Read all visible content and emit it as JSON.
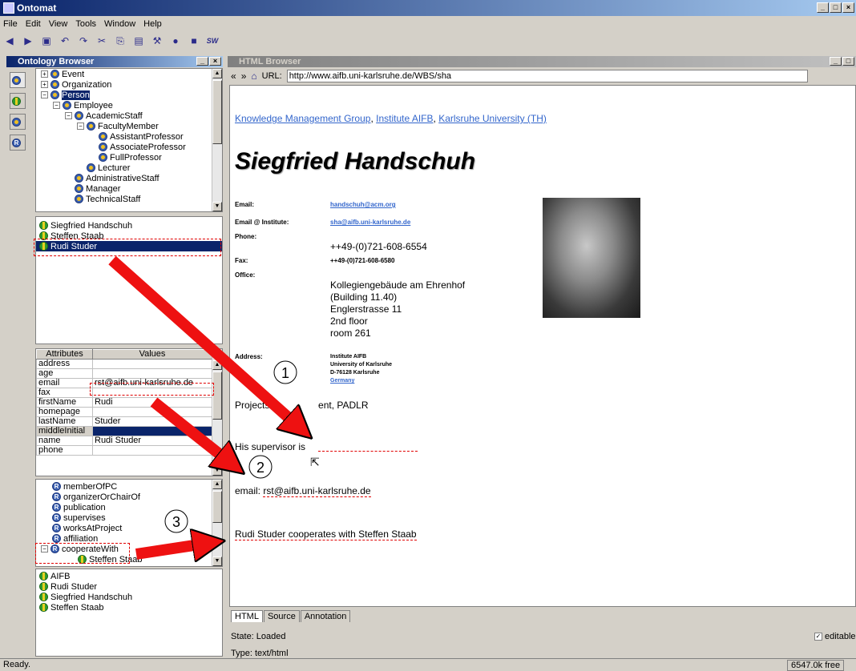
{
  "app": {
    "title": "Ontomat",
    "status": "Ready.",
    "memory": "6547.0k free"
  },
  "menu": [
    "File",
    "Edit",
    "View",
    "Tools",
    "Window",
    "Help"
  ],
  "toolbar": [
    {
      "icon": "back-icon",
      "glyph": "◀"
    },
    {
      "icon": "forward-icon",
      "glyph": "▶"
    },
    {
      "icon": "save-icon",
      "glyph": "▣"
    },
    {
      "icon": "undo-icon",
      "glyph": "↶"
    },
    {
      "icon": "redo-icon",
      "glyph": "↷"
    },
    {
      "icon": "cut-icon",
      "glyph": "✂"
    },
    {
      "icon": "copy-icon",
      "glyph": "⎘"
    },
    {
      "icon": "paste-icon",
      "glyph": "▤"
    },
    {
      "icon": "tools-icon",
      "glyph": "⚒"
    },
    {
      "icon": "ontology-icon",
      "glyph": "●"
    },
    {
      "icon": "database-icon",
      "glyph": "■"
    },
    {
      "icon": "sw-icon",
      "glyph": "SW"
    }
  ],
  "ontology_browser": {
    "title": "Ontology Browser",
    "tree": [
      {
        "label": "Event",
        "depth": 0,
        "exp": "+"
      },
      {
        "label": "Organization",
        "depth": 0,
        "exp": "+"
      },
      {
        "label": "Person",
        "depth": 0,
        "exp": "−",
        "selected": true
      },
      {
        "label": "Employee",
        "depth": 1,
        "exp": "−"
      },
      {
        "label": "AcademicStaff",
        "depth": 2,
        "exp": "−"
      },
      {
        "label": "FacultyMember",
        "depth": 3,
        "exp": "−"
      },
      {
        "label": "AssistantProfessor",
        "depth": 4
      },
      {
        "label": "AssociateProfessor",
        "depth": 4
      },
      {
        "label": "FullProfessor",
        "depth": 4
      },
      {
        "label": "Lecturer",
        "depth": 3
      },
      {
        "label": "AdministrativeStaff",
        "depth": 2
      },
      {
        "label": "Manager",
        "depth": 2
      },
      {
        "label": "TechnicalStaff",
        "depth": 2
      }
    ],
    "instances": [
      "Siegfried Handschuh",
      "Steffen Staab",
      "Rudi Studer"
    ],
    "attributes_header": {
      "col1": "Attributes",
      "col2": "Values"
    },
    "attributes": [
      {
        "name": "address",
        "value": ""
      },
      {
        "name": "age",
        "value": ""
      },
      {
        "name": "email",
        "value": "rst@aifb.uni-karlsruhe.de"
      },
      {
        "name": "fax",
        "value": ""
      },
      {
        "name": "firstName",
        "value": "Rudi"
      },
      {
        "name": "homepage",
        "value": ""
      },
      {
        "name": "lastName",
        "value": "Studer"
      },
      {
        "name": "middleInitial",
        "value": ""
      },
      {
        "name": "name",
        "value": "Rudi Studer"
      },
      {
        "name": "phone",
        "value": ""
      }
    ],
    "relations": [
      "memberOfPC",
      "organizerOrChairOf",
      "publication",
      "supervises",
      "worksAtProject",
      "affiliation",
      "cooperateWith",
      "Steffen Staab"
    ],
    "related_instances": [
      "AIFB",
      "Rudi Studer",
      "Siegfried Handschuh",
      "Steffen Staab"
    ]
  },
  "html_browser": {
    "title": "HTML Browser",
    "url_label": "URL:",
    "url": "http://www.aifb.uni-karlsruhe.de/WBS/sha",
    "nav": {
      "link1": "Knowledge Management Group",
      "link2": "Institute AIFB",
      "link3": "Karlsruhe University (TH)",
      "sep": ","
    },
    "heading": "Siegfried Handschuh",
    "labels": {
      "email": "Email:",
      "email_inst": "Email @ Institute:",
      "phone": "Phone:",
      "fax": "Fax:",
      "office": "Office:",
      "address": "Address:"
    },
    "values": {
      "email": "handschuh@acm.org",
      "email_inst": "sha@aifb.uni-karlsruhe.de",
      "phone": "++49-(0)721-608-6554",
      "fax": "++49-(0)721-608-6580",
      "office": [
        "Kollegiengebäude am Ehrenhof",
        "(Building 11.40)",
        "Englerstrasse 11",
        "2nd floor",
        "room 261"
      ],
      "address": [
        "Institute AIFB",
        "University of Karlsruhe",
        "D-76128 Karlsruhe",
        "Germany"
      ]
    },
    "projects": "Projects:",
    "projects_tail": "ent, PADLR",
    "supervisor": "His supervisor is",
    "email_line": "email:",
    "email_value": "rst@aifb.uni-karlsruhe.de",
    "cooperates": "Rudi Studer cooperates with Steffen Staab",
    "tabs": [
      "HTML",
      "Source",
      "Annotation"
    ],
    "state": "State: Loaded",
    "type": "Type: text/html",
    "editable": "editable"
  },
  "markers": [
    "1",
    "2",
    "3"
  ],
  "colors": {
    "arrow": "#ee1111",
    "link": "#3366cc",
    "selection": "#0a246a"
  }
}
